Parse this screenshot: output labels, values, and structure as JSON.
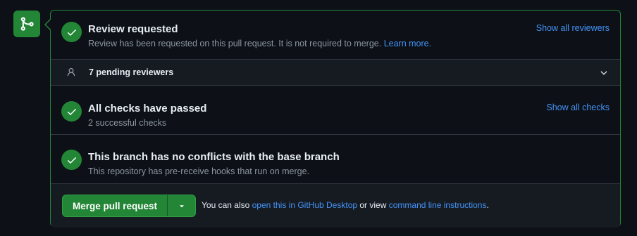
{
  "review": {
    "title": "Review requested",
    "description": "Review has been requested on this pull request. It is not required to merge.",
    "learn_more": "Learn more.",
    "show_all": "Show all reviewers"
  },
  "pending": {
    "label": "7 pending reviewers"
  },
  "checks": {
    "title": "All checks have passed",
    "description": "2 successful checks",
    "show_all": "Show all checks"
  },
  "conflicts": {
    "title": "This branch has no conflicts with the base branch",
    "description": "This repository has pre-receive hooks that run on merge."
  },
  "merge": {
    "button_label": "Merge pull request",
    "prefix": "You can also ",
    "desktop_link": "open this in GitHub Desktop",
    "middle": " or view ",
    "cli_link": "command line instructions",
    "suffix": "."
  },
  "colors": {
    "success": "#238636",
    "link": "#4493f8",
    "background": "#0d1117",
    "muted": "#8d96a0"
  },
  "icons": {
    "badge": "git-merge-icon",
    "status": "check-icon",
    "reviewers": "person-icon",
    "expand": "chevron-down-icon",
    "dropdown": "triangle-down-icon"
  }
}
